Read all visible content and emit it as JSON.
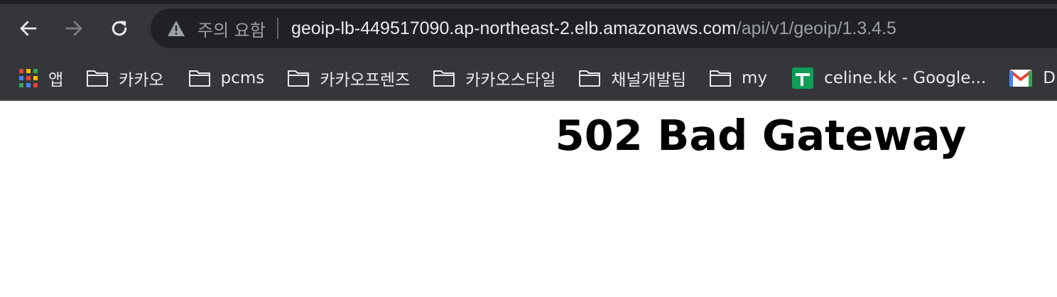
{
  "browser": {
    "nav": {
      "back_icon": "arrow-left-icon",
      "forward_icon": "arrow-right-icon",
      "reload_icon": "reload-icon"
    },
    "omnibox": {
      "security_icon": "warning-triangle-icon",
      "security_label": "주의 요함",
      "url_host": "geoip-lb-449517090.ap-northeast-2.elb.amazonaws.com",
      "url_path": "/api/v1/geoip/1.3.4.5"
    },
    "bookmarks": [
      {
        "label": "앱",
        "icon": "apps-grid-icon"
      },
      {
        "label": "카카오",
        "icon": "folder-icon"
      },
      {
        "label": "pcms",
        "icon": "folder-icon"
      },
      {
        "label": "카카오프렌즈",
        "icon": "folder-icon"
      },
      {
        "label": "카카오스타일",
        "icon": "folder-icon"
      },
      {
        "label": "채널개발팀",
        "icon": "folder-icon"
      },
      {
        "label": "my",
        "icon": "folder-icon"
      },
      {
        "label": "celine.kk - Google...",
        "icon": "google-sheets-icon"
      },
      {
        "label": "D",
        "icon": "gmail-icon"
      }
    ],
    "colors": {
      "toolbar_bg": "#35363a",
      "omnibox_bg": "#202124",
      "text_primary": "#e8eaed",
      "text_secondary": "#9aa0a6"
    }
  },
  "page": {
    "title": "502 Bad Gateway"
  }
}
